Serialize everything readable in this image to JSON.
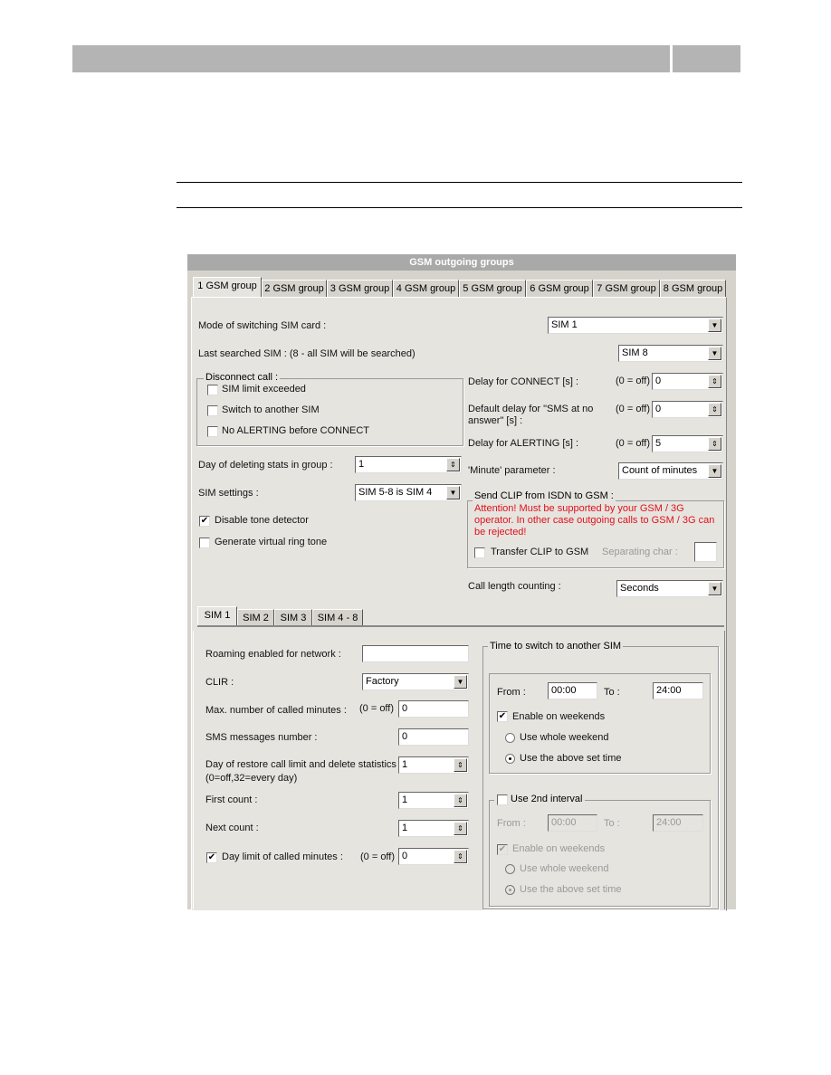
{
  "dialog": {
    "title": "GSM outgoing groups",
    "group_tabs": [
      "1 GSM group",
      "2 GSM group",
      "3 GSM group",
      "4 GSM group",
      "5 GSM group",
      "6 GSM group",
      "7 GSM group",
      "8 GSM group"
    ],
    "mode_label": "Mode of switching SIM card :",
    "mode_value": "SIM 1",
    "last_label": "Last searched SIM : (8 - all SIM will be searched)",
    "last_value": "SIM 8",
    "disconnect": {
      "legend": "Disconnect call :",
      "items": [
        {
          "label": "SIM limit exceeded",
          "checked": false
        },
        {
          "label": "Switch to another SIM",
          "checked": false
        },
        {
          "label": "No ALERTING before CONNECT",
          "checked": false
        }
      ]
    },
    "off_hint": "(0 = off)",
    "delay_connect_label": "Delay for CONNECT [s] :",
    "delay_connect_value": "0",
    "delay_sms_label": "Default delay for \"SMS at no answer\" [s] :",
    "delay_sms_value": "0",
    "delay_alert_label": "Delay for ALERTING [s] :",
    "delay_alert_value": "5",
    "day_delete_label": "Day of deleting stats in group :",
    "day_delete_value": "1",
    "minute_label": "'Minute' parameter :",
    "minute_value": "Count of minutes",
    "sim_settings_label": "SIM settings :",
    "sim_settings_value": "SIM 5-8 is SIM 4",
    "disable_tone": {
      "label": "Disable tone detector",
      "checked": true
    },
    "virtual_ring": {
      "label": "Generate virtual ring tone",
      "checked": false
    },
    "clip": {
      "legend": "Send CLIP from ISDN to GSM :",
      "warning": "Attention! Must be supported by your GSM / 3G operator. In other case outgoing calls to GSM / 3G can be rejected!",
      "transfer_label": "Transfer CLIP to GSM",
      "transfer_checked": false,
      "sep_label": "Separating char :",
      "sep_value": ""
    },
    "call_length_label": "Call length counting :",
    "call_length_value": "Seconds",
    "sim_tabs": [
      "SIM 1",
      "SIM 2",
      "SIM 3",
      "SIM 4 - 8"
    ],
    "sim": {
      "roaming_label": "Roaming enabled for network :",
      "roaming_value": "",
      "clir_label": "CLIR :",
      "clir_value": "Factory",
      "max_label": "Max. number of called minutes :",
      "max_value": "0",
      "sms_label": "SMS messages number :",
      "sms_value": "0",
      "restore_label": "Day of restore call limit and delete statistics :",
      "restore_hint": "(0=off,32=every day)",
      "restore_value": "1",
      "first_label": "First count :",
      "first_value": "1",
      "next_label": "Next count :",
      "next_value": "1",
      "daylimit_label": "Day limit of called minutes :",
      "daylimit_checked": true,
      "daylimit_value": "0",
      "switch": {
        "legend": "Time to switch to another SIM",
        "from_label": "From :",
        "to_label": "To :",
        "from": "00:00",
        "to": "24:00",
        "weekends": "Enable on weekends",
        "whole": "Use whole weekend",
        "above": "Use the above set time",
        "second_label": "Use 2nd interval",
        "second_checked": false,
        "from2": "00:00",
        "to2": "24:00"
      }
    }
  }
}
